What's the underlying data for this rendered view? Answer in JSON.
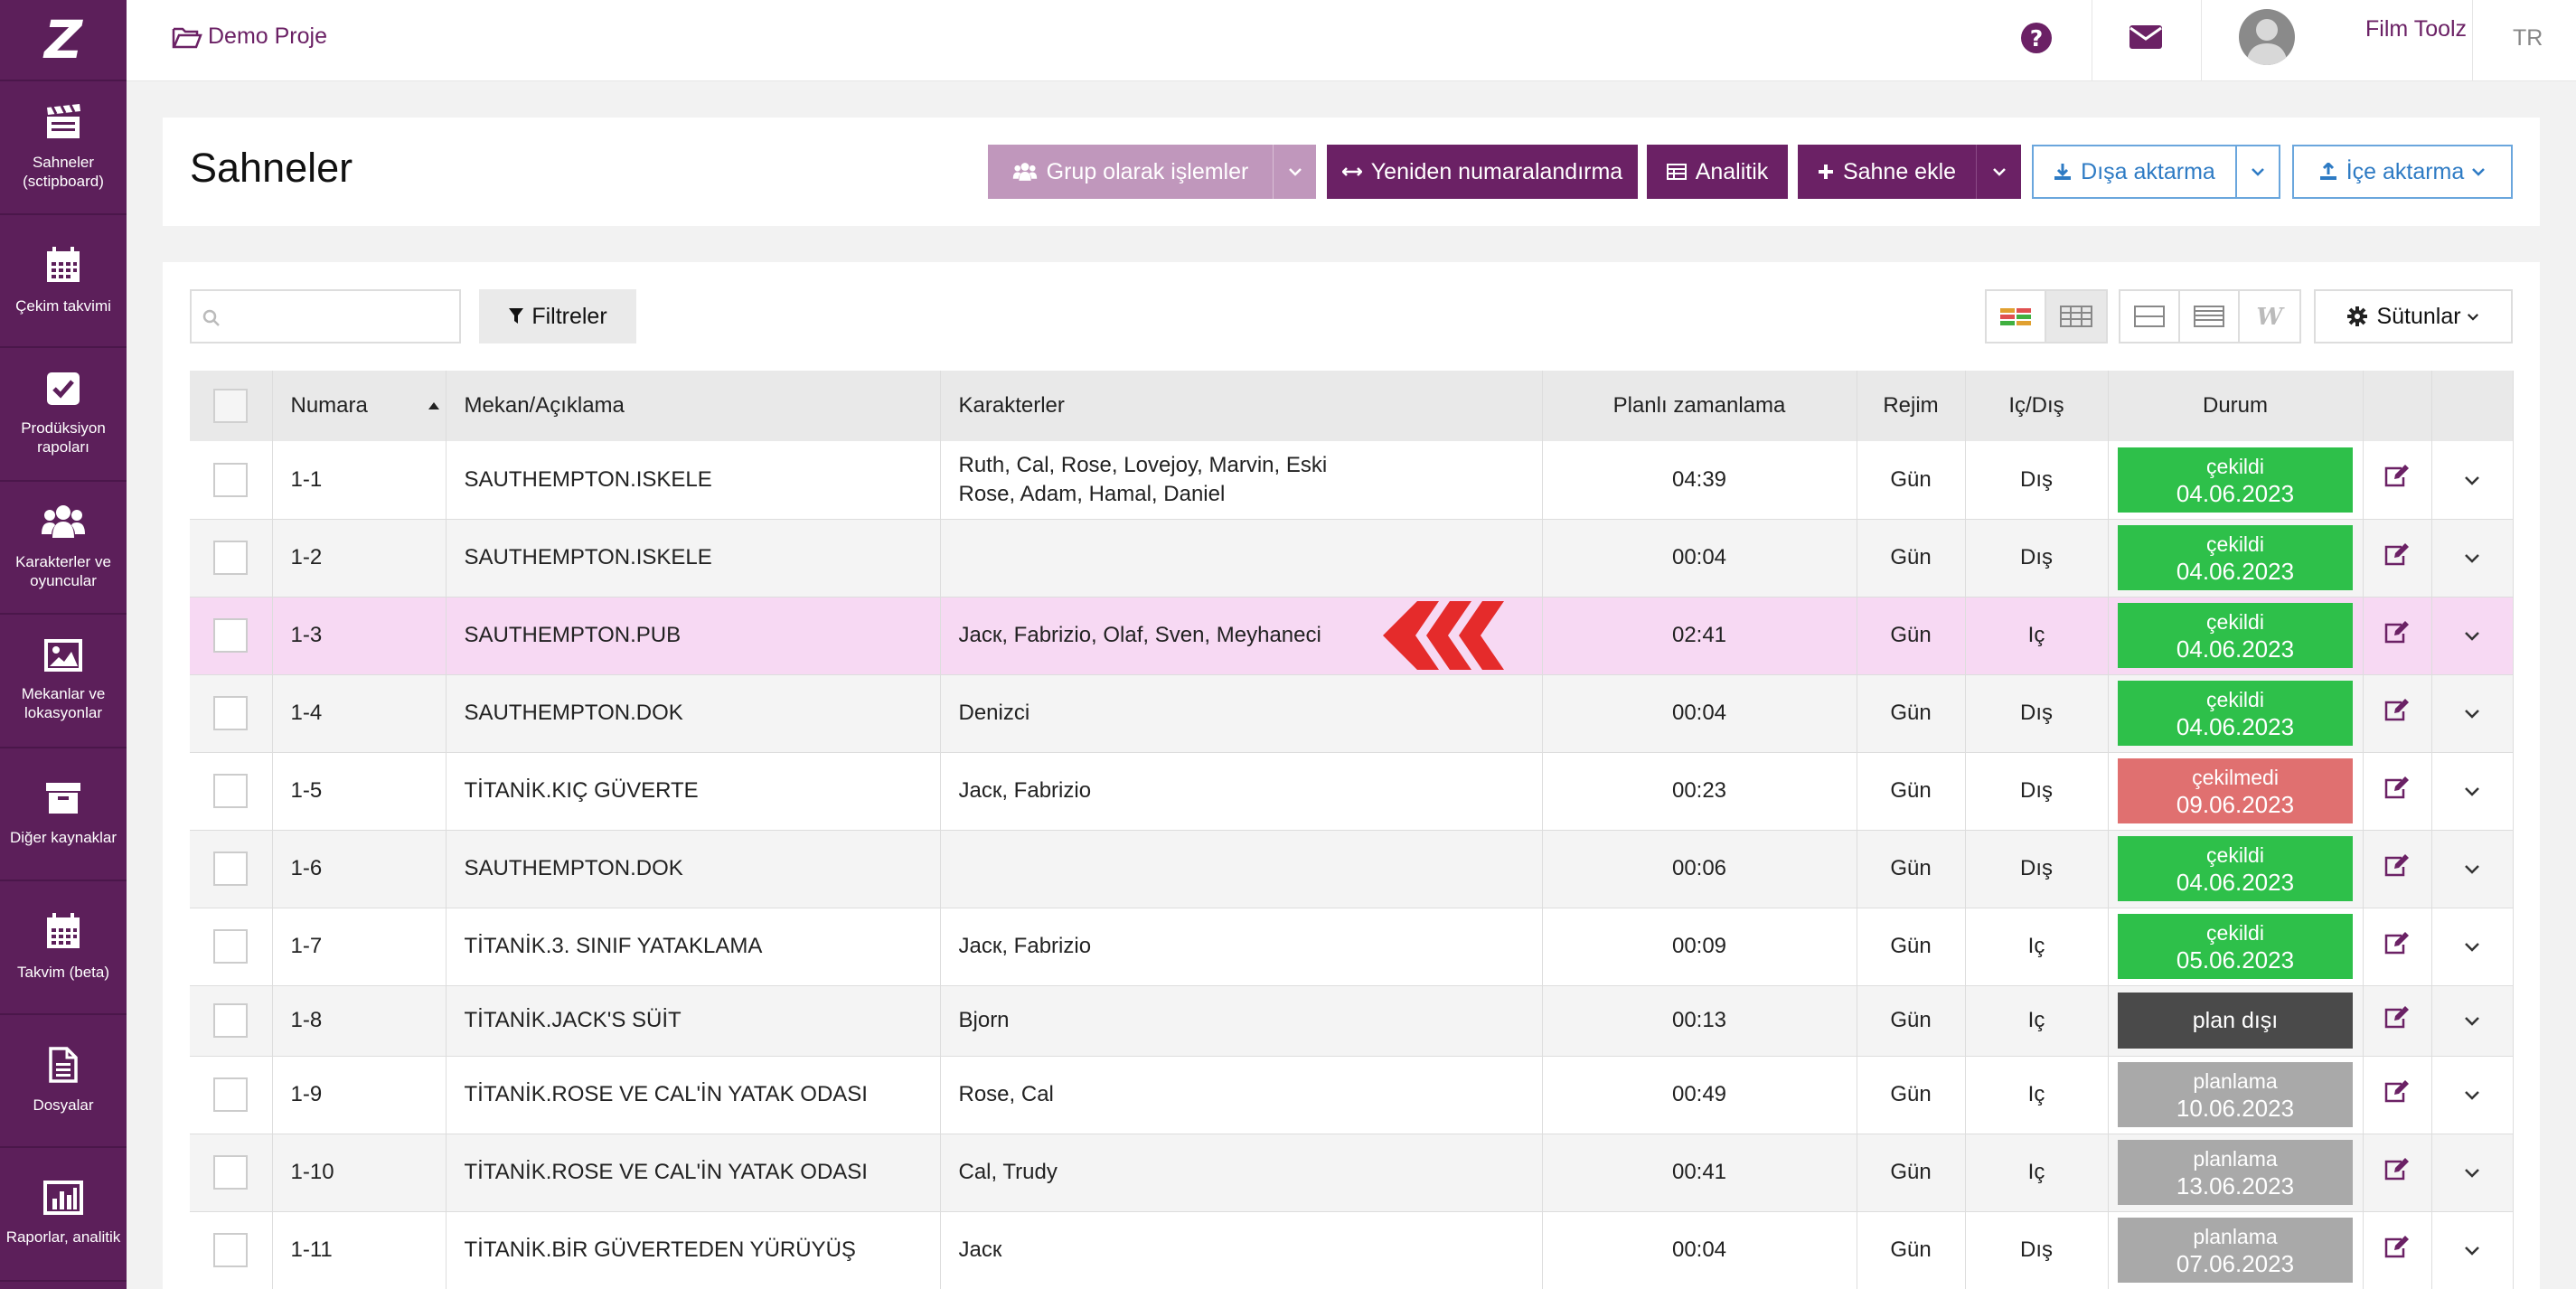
{
  "sidebar": {
    "logo": "Z",
    "items": [
      {
        "label": "Sahneler (sctipboard)",
        "icon": "clapperboard-icon"
      },
      {
        "label": "Çekim takvimi",
        "icon": "calendar-icon"
      },
      {
        "label": "Prodüksiyon rapoları",
        "icon": "checkbox-icon"
      },
      {
        "label": "Karakterler ve oyuncular",
        "icon": "users-icon"
      },
      {
        "label": "Mekanlar ve lokasyonlar",
        "icon": "picture-icon"
      },
      {
        "label": "Diğer kaynaklar",
        "icon": "archive-icon"
      },
      {
        "label": "Takvim (beta)",
        "icon": "calendar-icon"
      },
      {
        "label": "Dosyalar",
        "icon": "file-icon"
      },
      {
        "label": "Raporlar, analitik",
        "icon": "bar-chart-icon"
      }
    ]
  },
  "topbar": {
    "project": "Demo Proje",
    "user_name": "Film Toolz",
    "language": "TR"
  },
  "header": {
    "title": "Sahneler",
    "buttons": {
      "group": "Grup olarak işlemler",
      "renumber": "Yeniden numaralandırma",
      "analytics": "Analitik",
      "add_scene": "Sahne ekle",
      "export": "Dışa aktarma",
      "import": "İçe aktarma"
    }
  },
  "toolbar": {
    "search_placeholder": "",
    "filters": "Filtreler",
    "columns": "Sütunlar"
  },
  "colors": {
    "brand": "#6b2165",
    "shot": "#2ec04a",
    "not_shot": "#e07070",
    "unplanned": "#4a4a4a",
    "planning": "#a9a9a9",
    "highlight_row": "#f7d9f3",
    "arrow": "#e52b2b"
  },
  "table": {
    "headers": {
      "number": "Numara",
      "location": "Mekan/Açıklama",
      "characters": "Karakterler",
      "planned": "Planlı zamanlama",
      "regime": "Rejim",
      "inout": "Iç/Dış",
      "status": "Durum"
    },
    "sort_column": "number",
    "highlighted_row": "1-3",
    "rows": [
      {
        "number": "1-1",
        "location": "SAUTHEMPTON.ISKELE",
        "characters": "Ruth, Cal, Rose, Lovejoy, Marvin, Eski Rose, Adam, Hamal, Daniel",
        "planned": "04:39",
        "regime": "Gün",
        "inout": "Dış",
        "status": "çekildi",
        "date": "04.06.2023",
        "status_color": "#2ec04a"
      },
      {
        "number": "1-2",
        "location": "SAUTHEMPTON.ISKELE",
        "characters": "",
        "planned": "00:04",
        "regime": "Gün",
        "inout": "Dış",
        "status": "çekildi",
        "date": "04.06.2023",
        "status_color": "#2ec04a"
      },
      {
        "number": "1-3",
        "location": "SAUTHEMPTON.PUB",
        "characters": "Jacк, Fabrizio, Olaf, Sven, Meyhaneci",
        "planned": "02:41",
        "regime": "Gün",
        "inout": "Iç",
        "status": "çekildi",
        "date": "04.06.2023",
        "status_color": "#2ec04a"
      },
      {
        "number": "1-4",
        "location": "SAUTHEMPTON.DOK",
        "characters": "Denizci",
        "planned": "00:04",
        "regime": "Gün",
        "inout": "Dış",
        "status": "çekildi",
        "date": "04.06.2023",
        "status_color": "#2ec04a"
      },
      {
        "number": "1-5",
        "location": "TİTANİK.KIÇ GÜVERTE",
        "characters": "Jacк, Fabrizio",
        "planned": "00:23",
        "regime": "Gün",
        "inout": "Dış",
        "status": "çekilmedi",
        "date": "09.06.2023",
        "status_color": "#e07070"
      },
      {
        "number": "1-6",
        "location": "SAUTHEMPTON.DOK",
        "characters": "",
        "planned": "00:06",
        "regime": "Gün",
        "inout": "Dış",
        "status": "çekildi",
        "date": "04.06.2023",
        "status_color": "#2ec04a"
      },
      {
        "number": "1-7",
        "location": "TİTANİK.3. SINIF YATAKLAMA",
        "characters": "Jacк, Fabrizio",
        "planned": "00:09",
        "regime": "Gün",
        "inout": "Iç",
        "status": "çekildi",
        "date": "05.06.2023",
        "status_color": "#2ec04a"
      },
      {
        "number": "1-8",
        "location": "TİTANİK.JACK'S SÜİT",
        "characters": "Bjorn",
        "planned": "00:13",
        "regime": "Gün",
        "inout": "Iç",
        "status": "plan dışı",
        "date": "",
        "status_color": "#4a4a4a"
      },
      {
        "number": "1-9",
        "location": "TİTANİK.ROSE VE CAL'İN YATAK ODASI",
        "characters": "Rose, Cal",
        "planned": "00:49",
        "regime": "Gün",
        "inout": "Iç",
        "status": "planlama",
        "date": "10.06.2023",
        "status_color": "#a9a9a9"
      },
      {
        "number": "1-10",
        "location": "TİTANİK.ROSE VE CAL'İN YATAK ODASI",
        "characters": "Cal, Trudy",
        "planned": "00:41",
        "regime": "Gün",
        "inout": "Iç",
        "status": "planlama",
        "date": "13.06.2023",
        "status_color": "#a9a9a9"
      },
      {
        "number": "1-11",
        "location": "TİTANİK.BİR GÜVERTEDEN YÜRÜYÜŞ",
        "characters": "Jacк",
        "planned": "00:04",
        "regime": "Gün",
        "inout": "Dış",
        "status": "planlama",
        "date": "07.06.2023",
        "status_color": "#a9a9a9"
      }
    ]
  }
}
